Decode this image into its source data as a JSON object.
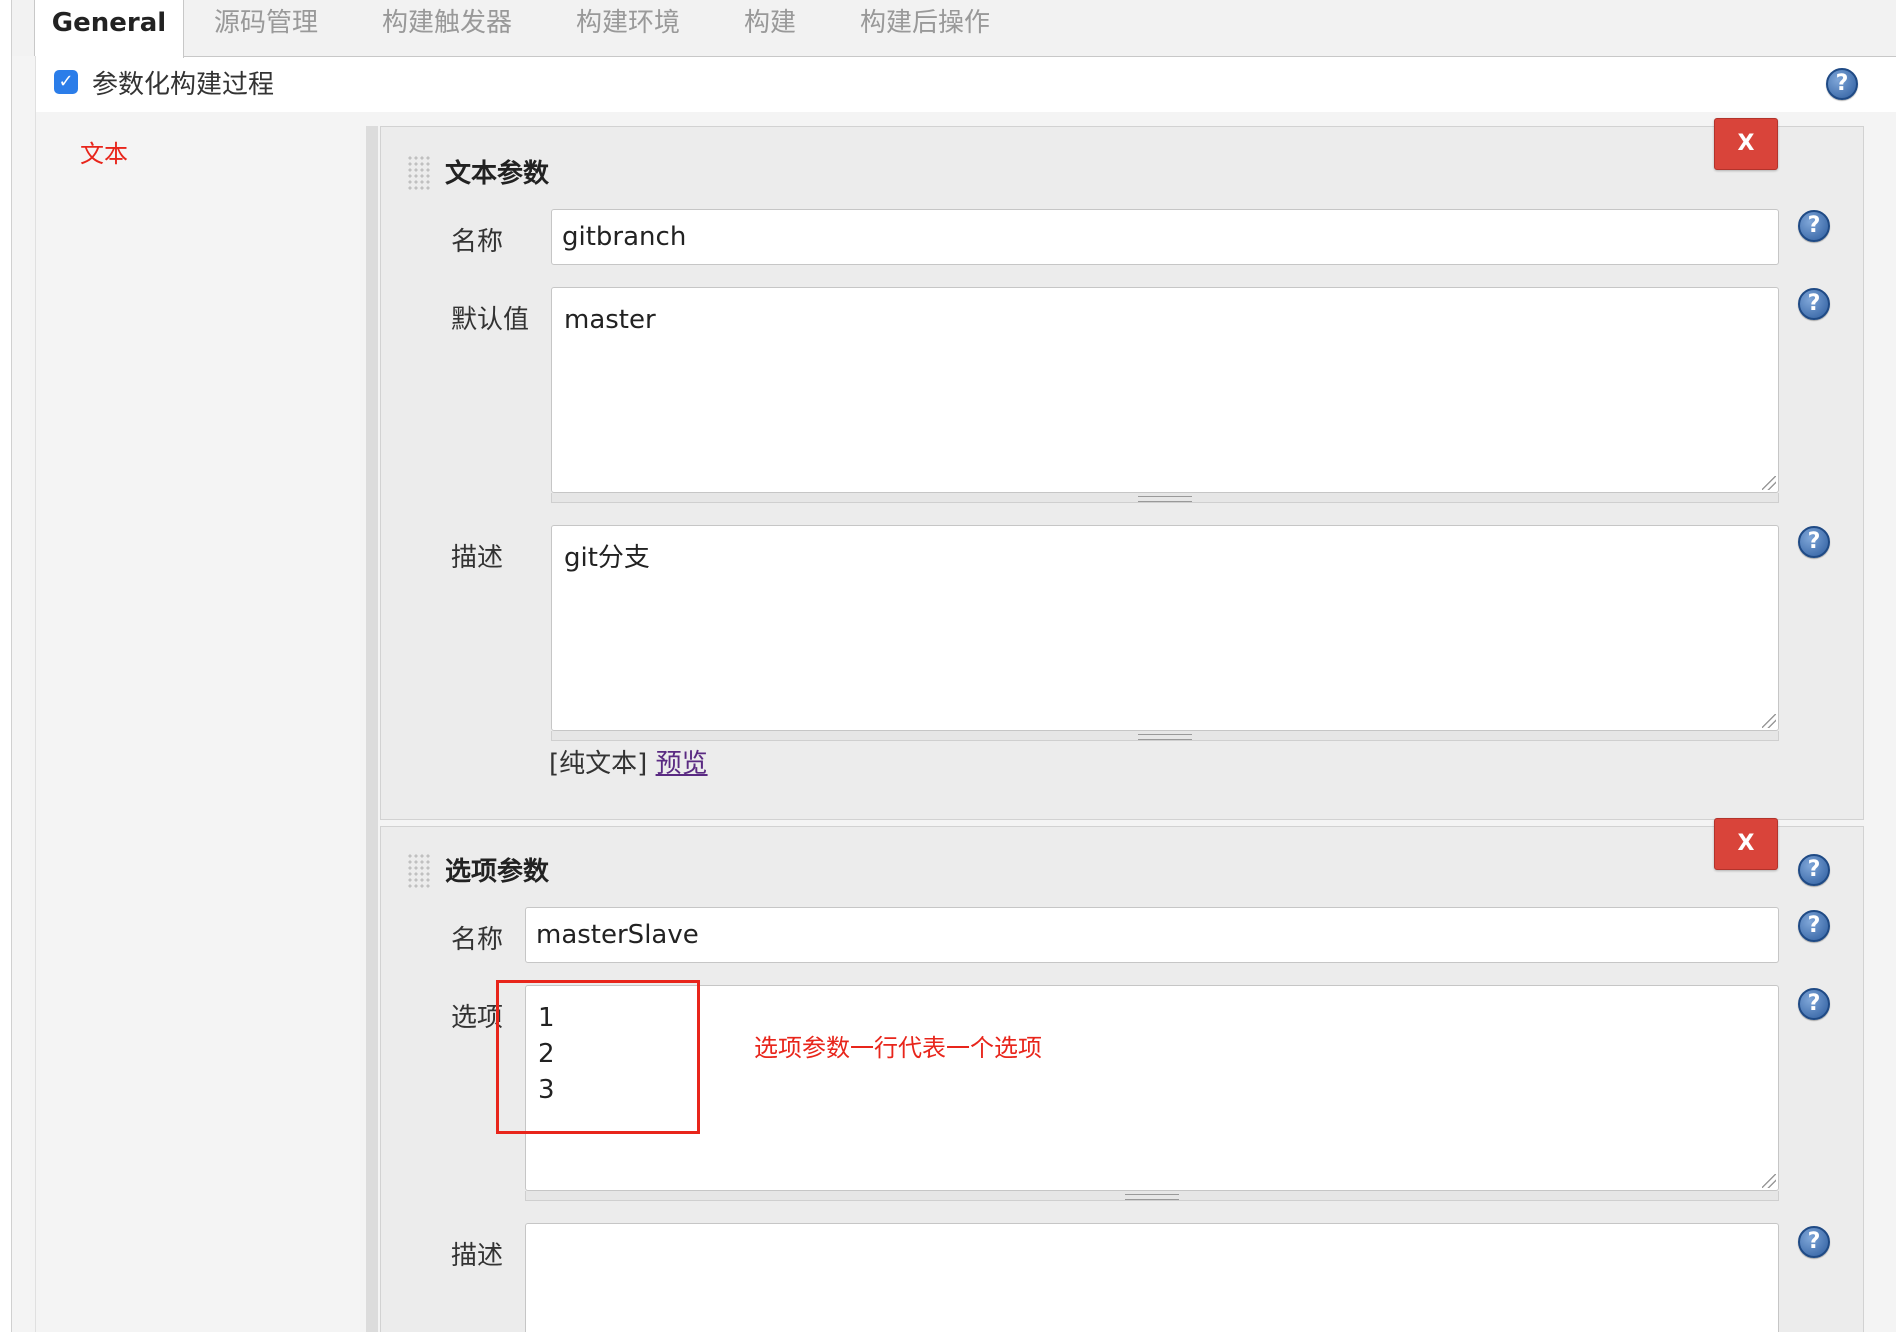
{
  "tabs": [
    {
      "label": "General",
      "active": true
    },
    {
      "label": "源码管理"
    },
    {
      "label": "构建触发器"
    },
    {
      "label": "构建环境"
    },
    {
      "label": "构建"
    },
    {
      "label": "构建后操作"
    }
  ],
  "parameterized": {
    "label": "参数化构建过程",
    "checked": true
  },
  "left_annotation": "文本",
  "text_param": {
    "title": "文本参数",
    "delete_label": "X",
    "name_label": "名称",
    "name_value": "gitbranch",
    "default_label": "默认值",
    "default_value": "master",
    "desc_label": "描述",
    "desc_value": "git分支",
    "plain_text": "[纯文本]",
    "preview": "预览"
  },
  "choice_param": {
    "title": "选项参数",
    "delete_label": "X",
    "name_label": "名称",
    "name_value": "masterSlave",
    "choices_label": "选项",
    "choices_value": "1\n2\n3",
    "desc_label": "描述",
    "desc_value": "",
    "annotation": "选项参数一行代表一个选项"
  },
  "help_symbol": "?",
  "colors": {
    "accent": "#2b7de9",
    "delete": "#d9443a",
    "annotation": "#e8251b",
    "link": "#5a2a82"
  }
}
